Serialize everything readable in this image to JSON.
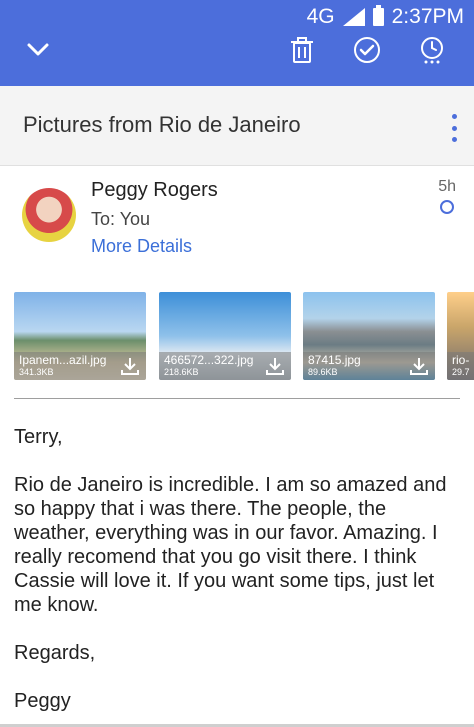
{
  "status_bar": {
    "network": "4G",
    "time": "2:37PM"
  },
  "action_bar": {
    "icons": [
      "chevron-down-icon",
      "trash-icon",
      "check-circle-icon",
      "snooze-clock-icon"
    ]
  },
  "email": {
    "subject": "Pictures from Rio de Janeiro",
    "sender": {
      "name": "Peggy Rogers",
      "to_line": "To: You",
      "more_details": "More Details",
      "time": "5h"
    },
    "attachments": [
      {
        "name": "Ipanem...azil.jpg",
        "size": "341.3KB"
      },
      {
        "name": "466572...322.jpg",
        "size": "218.6KB"
      },
      {
        "name": "87415.jpg",
        "size": "89.6KB"
      },
      {
        "name": "rio-",
        "size": "29.7"
      }
    ],
    "body": {
      "greeting": "Terry,",
      "paragraph": "Rio de Janeiro is incredible. I am so amazed and so happy that i was there. The people, the weather, everything was in our favor. Amazing. I really recomend that you go visit there. I think Cassie will love it. If you want some tips, just let me know.",
      "closing": "Regards,",
      "signature": "Peggy"
    }
  },
  "colors": {
    "accent": "#4c6edb",
    "link": "#3b6fd8"
  }
}
